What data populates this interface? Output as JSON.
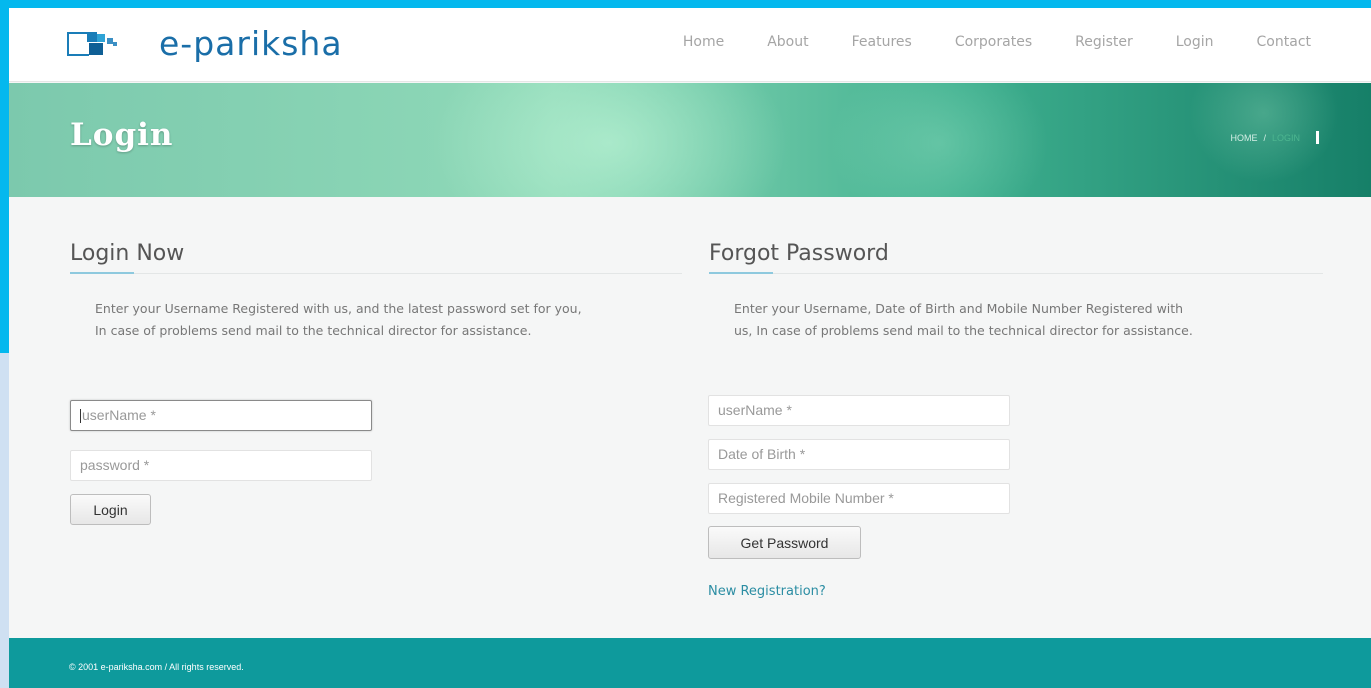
{
  "site": {
    "logo_text": "e-pariksha"
  },
  "nav": {
    "items": [
      {
        "label": "Home"
      },
      {
        "label": "About"
      },
      {
        "label": "Features"
      },
      {
        "label": "Corporates"
      },
      {
        "label": "Register"
      },
      {
        "label": "Login"
      },
      {
        "label": "Contact"
      }
    ]
  },
  "banner": {
    "title": "Login",
    "breadcrumb_home": "HOME",
    "breadcrumb_sep": "/",
    "breadcrumb_current": "LOGIN"
  },
  "login": {
    "heading": "Login Now",
    "description": "Enter your Username Registered with us, and the latest password set for you, In case of problems send mail to the technical director for assistance.",
    "username_placeholder": "userName *",
    "password_placeholder": "password *",
    "button_label": "Login"
  },
  "forgot": {
    "heading": "Forgot Password",
    "description": "Enter your Username, Date of Birth and Mobile Number Registered with us, In case of problems send mail to the technical director for assistance.",
    "username_placeholder": "userName *",
    "dob_placeholder": "Date of Birth *",
    "mobile_placeholder": "Registered Mobile Number *",
    "button_label": "Get Password",
    "register_link": "New Registration?"
  },
  "footer": {
    "text": "© 2001 e-pariksha.com / All rights reserved."
  },
  "colors": {
    "outer_frame": "#04b8ee",
    "banner_dark": "#167f68",
    "banner_light": "#8fd9b8",
    "footer": "#0e9a9c",
    "link": "#2b8da3",
    "logo_blue": "#1a6ea8"
  }
}
